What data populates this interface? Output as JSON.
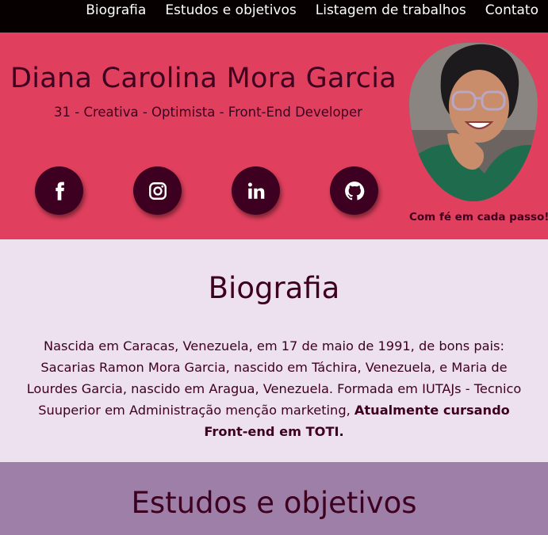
{
  "nav": {
    "items": [
      "Biografia",
      "Estudos e objetivos",
      "Listagem de trabalhos",
      "Contato"
    ]
  },
  "hero": {
    "name": "Diana Carolina Mora Garcia",
    "tagline": "31 - Creativa - Optimista - Front-End Developer",
    "motto": "Com fé em cada passo!",
    "social_icons": [
      "facebook-icon",
      "instagram-icon",
      "linkedin-icon",
      "github-icon"
    ]
  },
  "bio": {
    "title": "Biografia",
    "text": "Nascida em Caracas, Venezuela, em 17 de maio de 1991, de bons pais: Sacarias Ramon Mora Garcia, nascido em Táchira, Venezuela, e Maria de Lourdes Garcia, nascido em Aragua, Venezuela. Formada em IUTAJs - Tecnico Suuperior em Administração menção marketing,",
    "highlight": "Atualmente cursando Front-end em TOTI."
  },
  "studies": {
    "title": "Estudos e objetivos"
  },
  "colors": {
    "nav_bg": "#060000",
    "hero_bg": "#e0405e",
    "accent_dark": "#3e0020",
    "bio_bg": "#ede1ef",
    "studies_bg": "#9e7fa8"
  }
}
